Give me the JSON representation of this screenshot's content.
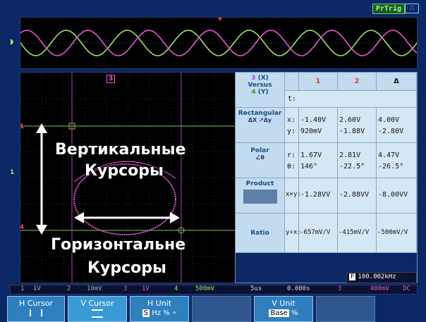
{
  "header": {
    "trigger_badge": "PrTrig",
    "trigger_icon": "trigger-edge-icon"
  },
  "overlay": {
    "vertical_cursors_line1": "Вертикальные",
    "vertical_cursors_line2": "Курсоры",
    "horizontal_cursors_line1": "Горизонтальне",
    "horizontal_cursors_line2": "Курсоры"
  },
  "markers": {
    "ch3_top": "3",
    "ch1_left_top": "1",
    "ch1_left_mid": "1",
    "ch1_left_bot": "4"
  },
  "table": {
    "versus": {
      "line1_ch": "3",
      "line1_axis": "(X)",
      "line2": "Versus",
      "line3_ch": "4",
      "line3_axis": "(Y)"
    },
    "header_cols": [
      "1",
      "2",
      "Δ"
    ],
    "t_label": "t:",
    "rows": [
      {
        "label": "Rectangular",
        "subs": [
          "x:",
          "y:"
        ],
        "c1": [
          "-1.40V",
          "920mV"
        ],
        "c2": [
          "2.60V",
          "-1.88V"
        ],
        "d": [
          "4.00V",
          "-2.80V"
        ]
      },
      {
        "label": "Polar",
        "subs": [
          "r:",
          "θ:"
        ],
        "c1": [
          "1.67V",
          "146°"
        ],
        "c2": [
          "2.81V",
          "-22.5°"
        ],
        "d": [
          "4.47V",
          "-26.5°"
        ]
      },
      {
        "label": "Product",
        "subs": [
          "x×y:"
        ],
        "c1": [
          "-1.28VV"
        ],
        "c2": [
          "-2.88VV"
        ],
        "d": [
          "-8.00VV"
        ]
      },
      {
        "label": "Ratio",
        "subs": [
          "y÷x:"
        ],
        "c1": [
          "-657mV/V"
        ],
        "c2": [
          "-415mV/V"
        ],
        "d": [
          "-500mV/V"
        ]
      }
    ]
  },
  "freq": {
    "label": "F",
    "value": "100.002kHz"
  },
  "status": {
    "ch1": "1",
    "ch1_scale": "1V",
    "ch2": "2",
    "ch2_scale": "10mV",
    "ch3": "3",
    "ch3_scale": "1V",
    "ch4": "4",
    "ch4_scale": "500mV",
    "timebase": "5us",
    "trig_pos": "0.000s",
    "trig_ch": "3",
    "trig_level": "400mV",
    "coupling": "DC"
  },
  "softkeys": [
    {
      "label": "H Cursor",
      "sub": "",
      "selected": false
    },
    {
      "label": "V Cursor",
      "sub": "",
      "selected": true
    },
    {
      "label": "H Unit",
      "sub": "Hz % ∘",
      "sub_prefix": "S",
      "selected": false
    },
    {
      "label": "",
      "sub": "",
      "dim": true
    },
    {
      "label": "V Unit",
      "sub": "%",
      "sub_prefix": "Base",
      "selected": false
    },
    {
      "label": "",
      "sub": "",
      "dim": true
    }
  ]
}
